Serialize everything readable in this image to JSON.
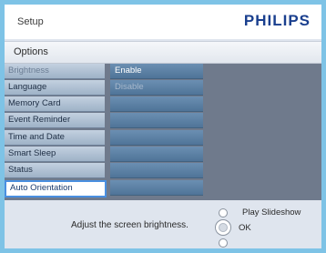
{
  "header": {
    "title": "Setup",
    "brand": "PHILIPS"
  },
  "options": {
    "label": "Options"
  },
  "menu": {
    "items": [
      {
        "label": "Brightness",
        "state": "dim"
      },
      {
        "label": "Language",
        "state": "normal"
      },
      {
        "label": "Memory Card",
        "state": "normal"
      },
      {
        "label": "Event Reminder",
        "state": "normal"
      },
      {
        "label": "Time and Date",
        "state": "normal"
      },
      {
        "label": "Smart Sleep",
        "state": "normal"
      },
      {
        "label": "Status",
        "state": "normal"
      },
      {
        "label": "Auto Orientation",
        "state": "active"
      }
    ]
  },
  "submenu": {
    "items": [
      {
        "label": "Enable",
        "state": "normal"
      },
      {
        "label": "Disable",
        "state": "dim"
      },
      {
        "label": "",
        "state": "normal"
      },
      {
        "label": "",
        "state": "normal"
      },
      {
        "label": "",
        "state": "normal"
      },
      {
        "label": "",
        "state": "normal"
      },
      {
        "label": "",
        "state": "normal"
      },
      {
        "label": "",
        "state": "normal"
      }
    ]
  },
  "footer": {
    "help": "Adjust the screen brightness.",
    "slideshow_label": "Play Slideshow",
    "ok_label": "OK"
  }
}
